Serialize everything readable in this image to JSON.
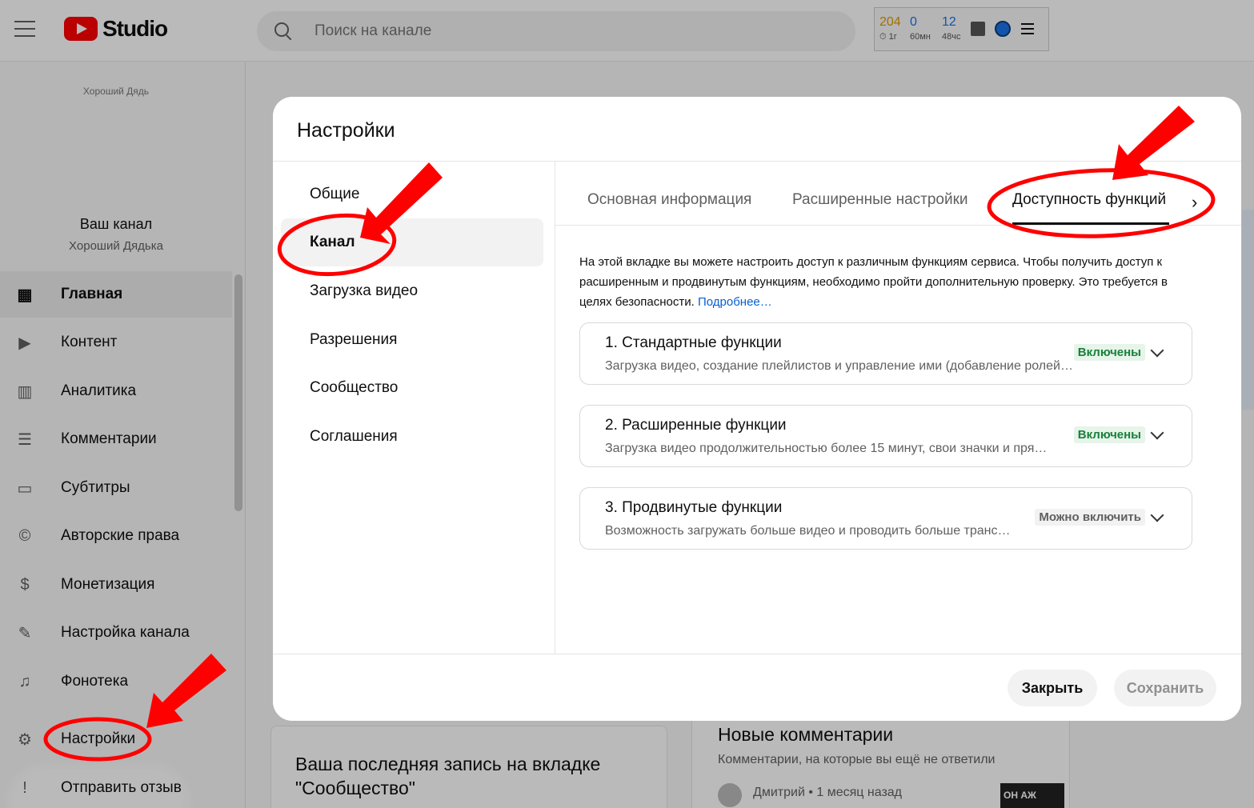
{
  "header": {
    "logo_text": "Studio",
    "search_placeholder": "Поиск на канале",
    "stats": [
      {
        "value": "204",
        "sub": "1г",
        "color": "#e09a00"
      },
      {
        "value": "0",
        "sub": "60мн",
        "color": "#1a73e8"
      },
      {
        "value": "12",
        "sub": "48чс",
        "color": "#1a73e8"
      }
    ]
  },
  "sidebar": {
    "channel_top_text": "Хороший Дядь",
    "channel_title": "Ваш канал",
    "channel_name": "Хороший Дядька",
    "items": [
      {
        "label": "Главная",
        "icon": "dashboard-icon"
      },
      {
        "label": "Контент",
        "icon": "content-icon"
      },
      {
        "label": "Аналитика",
        "icon": "analytics-icon"
      },
      {
        "label": "Комментарии",
        "icon": "comments-icon"
      },
      {
        "label": "Субтитры",
        "icon": "subtitles-icon"
      },
      {
        "label": "Авторские права",
        "icon": "copyright-icon"
      },
      {
        "label": "Монетизация",
        "icon": "monetization-icon"
      },
      {
        "label": "Настройка канала",
        "icon": "customization-icon"
      },
      {
        "label": "Фонотека",
        "icon": "audio-library-icon"
      },
      {
        "label": "Настройки",
        "icon": "settings-icon"
      },
      {
        "label": "Отправить отзыв",
        "icon": "feedback-icon"
      }
    ]
  },
  "background": {
    "community_card_title": "Ваша последняя запись на вкладке \"Сообщество\"",
    "comments_title": "Новые комментарии",
    "comments_sub": "Комментарии, на которые вы ещё не ответили",
    "comment_author": "Дмитрий • 1 месяц назад",
    "thumb_text": "ОН АЖ"
  },
  "dialog": {
    "title": "Настройки",
    "left_menu": [
      "Общие",
      "Канал",
      "Загрузка видео",
      "Разрешения",
      "Сообщество",
      "Соглашения"
    ],
    "tabs": [
      "Основная информация",
      "Расширенные настройки",
      "Доступность функций"
    ],
    "description": "На этой вкладке вы можете настроить доступ к различным функциям сервиса. Чтобы получить доступ к расширенным и продвинутым функциям, необходимо пройти дополнительную проверку. Это требуется в целях безопасности.",
    "description_link": "Подробнее…",
    "features": [
      {
        "title": "1. Стандартные функции",
        "subtitle": "Загрузка видео, создание плейлистов и управление ими (добавление ролей…",
        "status": "Включены"
      },
      {
        "title": "2. Расширенные функции",
        "subtitle": "Загрузка видео продолжительностью более 15 минут, свои значки и пря…",
        "status": "Включены"
      },
      {
        "title": "3. Продвинутые функции",
        "subtitle": "Возможность загружать больше видео и проводить больше транс…",
        "status": "Можно включить"
      }
    ],
    "close_label": "Закрыть",
    "save_label": "Сохранить"
  },
  "colors": {
    "accent_red": "#ff0000",
    "annotation_red": "#ff0000",
    "link_blue": "#065fd4",
    "enabled_green": "#188038"
  }
}
